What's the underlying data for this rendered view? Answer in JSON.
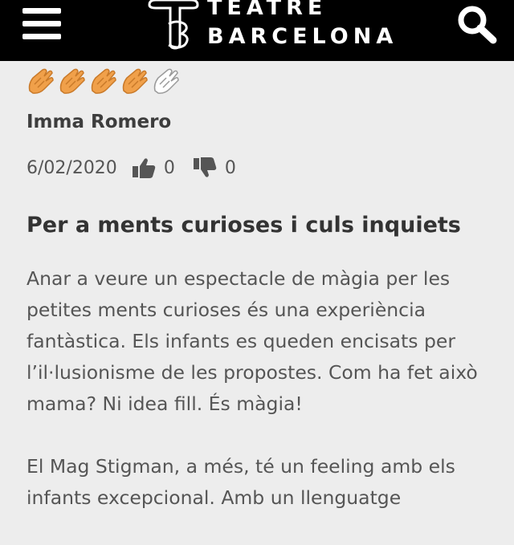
{
  "header": {
    "brand_line1": "TEATRE",
    "brand_line2": "BARCELONA",
    "menu_icon": "hamburger-menu-icon",
    "search_icon": "search-icon",
    "background_color": "#000000"
  },
  "review": {
    "rating": {
      "value": 4,
      "max": 5,
      "icon": "clapping-hands-icon",
      "active_color": "#f0a04a"
    },
    "author": "Imma Romero",
    "date": "6/02/2020",
    "likes": "0",
    "dislikes": "0",
    "title": "Per a ments curioses i culs inquiets",
    "paragraphs": [
      "Anar a veure un espectacle de màgia per les petites ments curioses és una experiència fantàstica. Els infants es queden encisats per l’il·lusionisme de les propostes. Com ha fet això mama? Ni idea fill. És màgia!",
      "El Mag Stigman, a més, té un feeling amb els infants excepcional. Amb un llenguatge"
    ]
  }
}
